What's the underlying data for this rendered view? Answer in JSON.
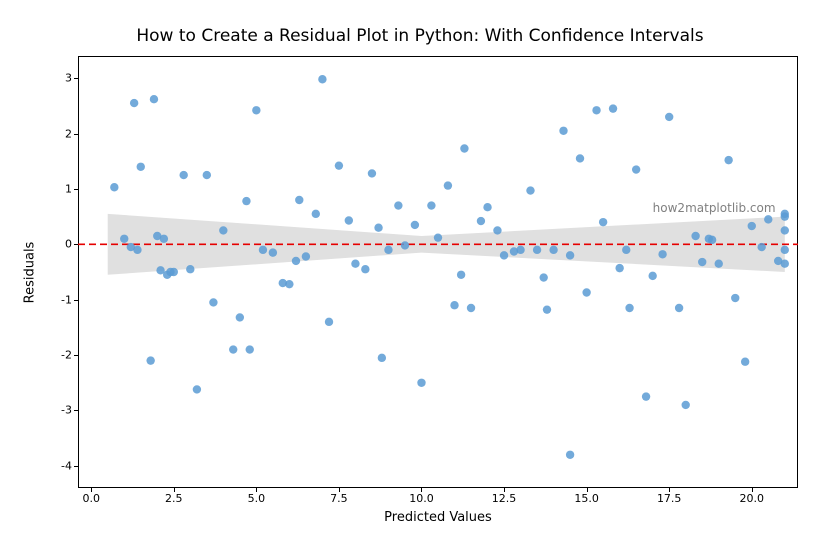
{
  "chart_data": {
    "type": "scatter",
    "title": "How to Create a Residual Plot in Python: With Confidence Intervals",
    "xlabel": "Predicted Values",
    "ylabel": "Residuals",
    "xlim": [
      -0.4,
      21.4
    ],
    "ylim": [
      -4.4,
      3.4
    ],
    "xticks": [
      0.0,
      2.5,
      5.0,
      7.5,
      10.0,
      12.5,
      15.0,
      17.5,
      20.0
    ],
    "yticks": [
      -4,
      -3,
      -2,
      -1,
      0,
      1,
      2,
      3
    ],
    "zero_line": {
      "y": 0,
      "color": "#ff0000",
      "style": "dashed"
    },
    "confidence_band": {
      "x": [
        0.5,
        10.0,
        21.0
      ],
      "upper": [
        0.55,
        0.15,
        0.5
      ],
      "lower": [
        -0.55,
        -0.15,
        -0.5
      ],
      "color": "#dcdcdc"
    },
    "series": [
      {
        "name": "residuals",
        "color": "#5a9bd4",
        "x": [
          0.7,
          1.0,
          1.2,
          1.3,
          1.4,
          1.5,
          1.8,
          1.9,
          2.0,
          2.1,
          2.2,
          2.3,
          2.4,
          2.5,
          2.8,
          3.0,
          3.2,
          3.5,
          3.7,
          4.0,
          4.3,
          4.5,
          4.8,
          5.0,
          5.2,
          5.5,
          5.8,
          6.0,
          6.3,
          6.5,
          6.8,
          7.0,
          7.2,
          7.5,
          7.8,
          8.0,
          8.3,
          8.5,
          8.8,
          9.0,
          9.3,
          9.5,
          9.8,
          10.0,
          10.3,
          10.5,
          10.8,
          11.0,
          11.3,
          11.5,
          11.8,
          12.0,
          12.3,
          12.5,
          12.8,
          13.0,
          13.3,
          13.5,
          13.8,
          14.0,
          14.3,
          14.5,
          14.8,
          15.0,
          15.3,
          15.5,
          15.8,
          16.0,
          16.3,
          16.5,
          16.8,
          17.0,
          17.3,
          17.5,
          17.8,
          18.0,
          18.3,
          18.5,
          18.8,
          19.0,
          19.3,
          19.5,
          19.8,
          20.0,
          20.3,
          20.5,
          20.8,
          21.0,
          21.0,
          21.0,
          21.0,
          21.0,
          4.7,
          6.2,
          8.7,
          11.2,
          13.7,
          16.2,
          18.7,
          14.5
        ],
        "y": [
          1.03,
          0.1,
          -0.05,
          2.55,
          -0.1,
          1.4,
          -2.1,
          2.62,
          0.15,
          -0.47,
          0.1,
          -0.55,
          -0.5,
          -0.5,
          1.25,
          -0.45,
          -2.62,
          1.25,
          -1.05,
          0.25,
          -1.9,
          -1.32,
          -1.9,
          2.42,
          -0.1,
          -0.15,
          -0.7,
          -0.72,
          0.8,
          -0.22,
          0.55,
          2.98,
          -1.4,
          1.42,
          0.43,
          -0.35,
          -0.45,
          1.28,
          -2.05,
          -0.1,
          0.7,
          -0.02,
          0.35,
          -2.5,
          0.7,
          0.12,
          1.06,
          -1.1,
          1.73,
          -1.15,
          0.42,
          0.67,
          0.25,
          -0.2,
          -0.13,
          -0.1,
          0.97,
          -0.1,
          -1.18,
          -0.1,
          2.05,
          -0.2,
          1.55,
          -0.87,
          2.42,
          0.4,
          2.45,
          -0.43,
          -1.15,
          1.35,
          -2.75,
          -0.57,
          -0.18,
          2.3,
          -1.15,
          -2.9,
          0.15,
          -0.32,
          0.08,
          -0.35,
          1.52,
          -0.97,
          -2.12,
          0.33,
          -0.05,
          0.45,
          -0.3,
          0.55,
          0.5,
          0.25,
          -0.1,
          -0.35,
          0.78,
          -0.3,
          0.3,
          -0.55,
          -0.6,
          -0.1,
          0.1,
          -3.8
        ]
      }
    ],
    "watermark": "how2matplotlib.com"
  },
  "colors": {
    "point": "#5a9bd4",
    "zero_line": "#e60000",
    "band": "#e0e0e0",
    "axis": "#000000"
  }
}
